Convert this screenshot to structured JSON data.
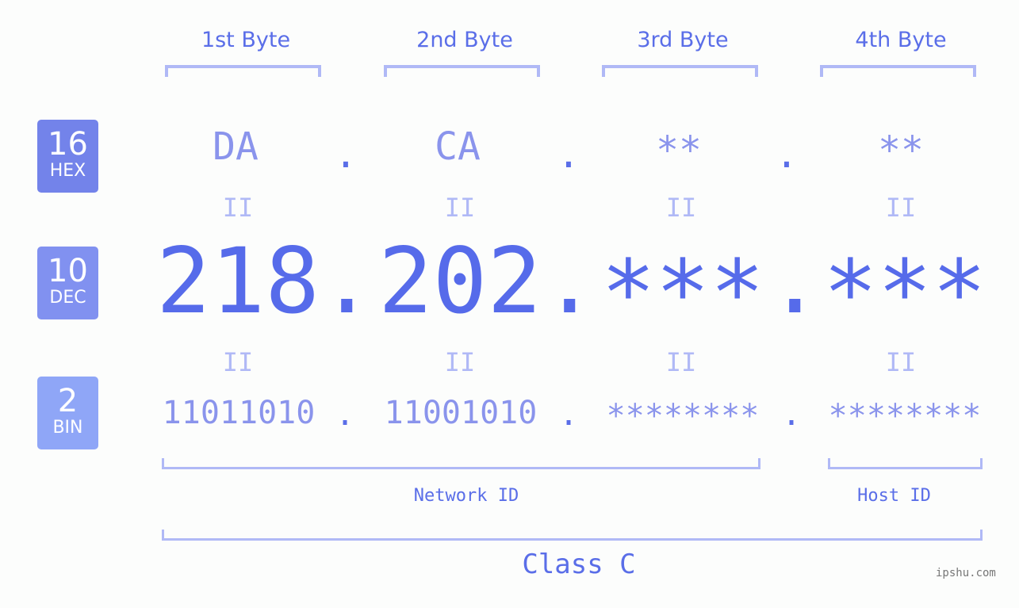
{
  "bytes": [
    {
      "header": "1st Byte",
      "hex": "DA",
      "dec": "218",
      "bin": "11011010"
    },
    {
      "header": "2nd Byte",
      "hex": "CA",
      "dec": "202",
      "bin": "11001010"
    },
    {
      "header": "3rd Byte",
      "hex": "**",
      "dec": "***",
      "bin": "********"
    },
    {
      "header": "4th Byte",
      "hex": "**",
      "dec": "***",
      "bin": "********"
    }
  ],
  "separator": ".",
  "equals": "II",
  "badges": {
    "hex": {
      "num": "16",
      "label": "HEX",
      "color": "#7383ea"
    },
    "dec": {
      "num": "10",
      "label": "DEC",
      "color": "#8191f0"
    },
    "bin": {
      "num": "2",
      "label": "BIN",
      "color": "#8fa6f7"
    }
  },
  "labels": {
    "network_id": "Network ID",
    "host_id": "Host ID",
    "class": "Class C"
  },
  "watermark": "ipshu.com",
  "colors": {
    "accent": "#566bea",
    "light": "#8a94ec",
    "bracket": "#b0b9f6"
  }
}
